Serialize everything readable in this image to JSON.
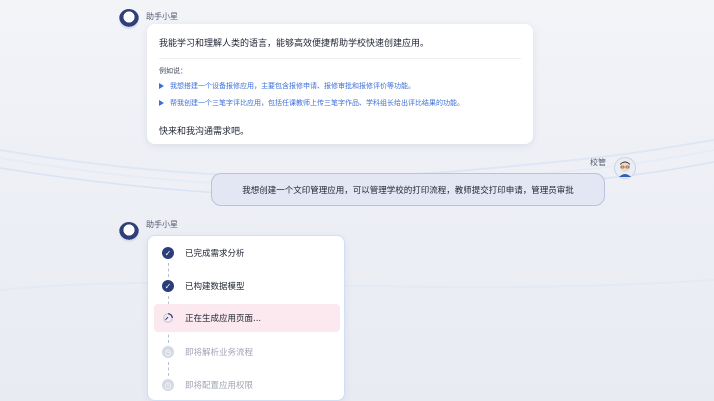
{
  "assistant": {
    "name": "助手小星",
    "intro": "我能学习和理解人类的语言，能够高效便捷帮助学校快速创建应用。",
    "example_heading": "例如说：",
    "suggestions": [
      "我想搭建一个设备报修应用，主要包含报修申请、报修审批和报修评价等功能。",
      "帮我创建一个三笔字评比应用，包括任课教师上传三笔字作品、学科组长给出评比结果的功能。"
    ],
    "closing": "快来和我沟通需求吧。"
  },
  "user": {
    "name": "校管",
    "message": "我想创建一个文印管理应用，可以管理学校的打印流程，教师提交打印申请，管理员审批"
  },
  "assistant_reply": {
    "name": "助手小星",
    "steps": [
      {
        "label": "已完成需求分析",
        "status": "done"
      },
      {
        "label": "已构建数据模型",
        "status": "done"
      },
      {
        "label": "正在生成应用页面...",
        "status": "active"
      },
      {
        "label": "即将解析业务流程",
        "status": "pending"
      },
      {
        "label": "即将配置应用权限",
        "status": "pending"
      }
    ]
  }
}
